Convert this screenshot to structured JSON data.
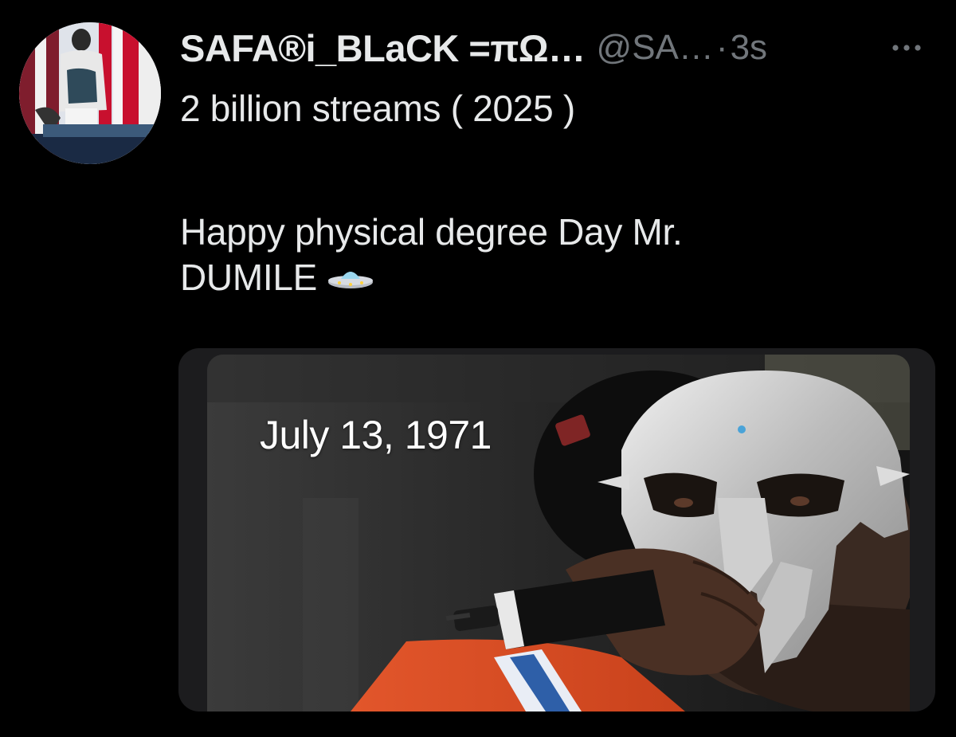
{
  "tweet": {
    "display_name": "SAFA®i_BLaCK =πΩ…",
    "handle": "@SA…",
    "separator": "·",
    "timestamp": "3s",
    "text_line1": "2 billion streams ( 2025 )",
    "text_line2_part1": "Happy physical degree Day Mr.",
    "text_line2_part2": "DUMILE",
    "emoji": "ufo-emoji"
  },
  "media": {
    "caption": "July 13, 1971"
  },
  "colors": {
    "background": "#000000",
    "primary_text": "#e7e9ea",
    "secondary_text": "#71767b",
    "card_border": "#1c1c1e"
  },
  "icons": [
    "more-icon",
    "avatar",
    "ufo-emoji"
  ]
}
